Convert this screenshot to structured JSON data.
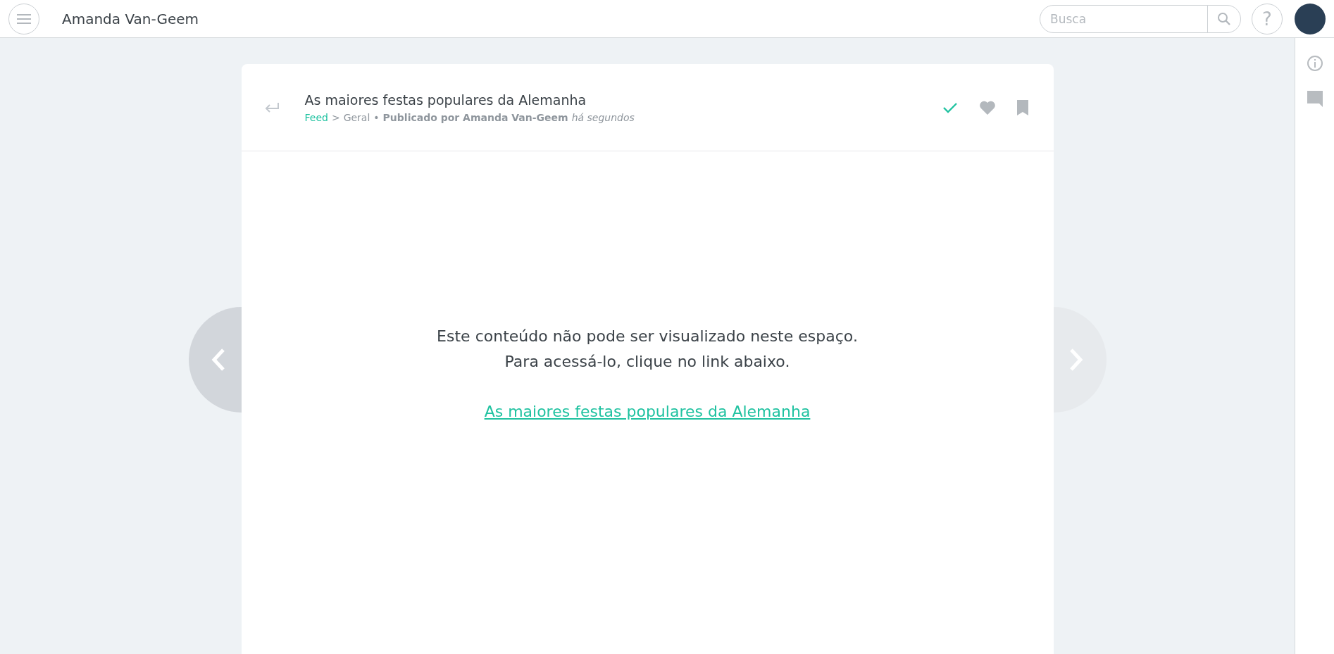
{
  "header": {
    "user_name": "Amanda Van-Geem",
    "search": {
      "placeholder": "Busca"
    },
    "help": "?"
  },
  "post": {
    "title": "As maiores festas populares da Alemanha",
    "breadcrumb": {
      "link": "Feed",
      "separator": ">",
      "category": "Geral",
      "bullet": "•",
      "author": "Publicado por Amanda Van-Geem",
      "time": "há segundos"
    },
    "actions": {
      "done": true,
      "liked": false,
      "saved": false
    },
    "message": [
      "Este conteúdo não pode ser visualizado neste espaço.",
      "Para acessá-lo, clique no link abaixo."
    ],
    "link": "As maiores festas populares da Alemanha",
    "prev_enabled": true,
    "next_enabled": false
  }
}
